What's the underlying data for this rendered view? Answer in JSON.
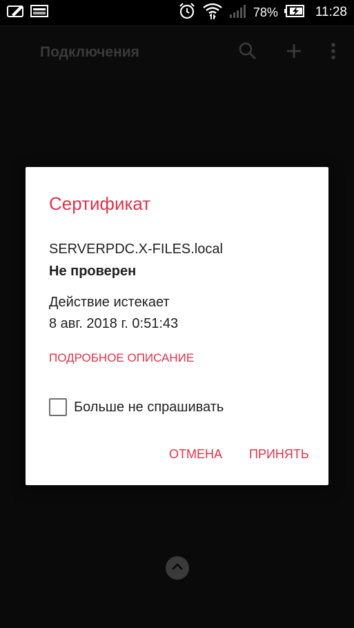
{
  "status_bar": {
    "battery_percent": "78%",
    "time": "11:28",
    "icons": [
      "edit-note-icon",
      "image-icon",
      "alarm-icon",
      "wifi-icon",
      "signal-icon",
      "battery-charging-icon"
    ]
  },
  "app_bar": {
    "title": "Подключения",
    "actions": [
      "search-icon",
      "add-icon",
      "more-vert-icon"
    ]
  },
  "dialog": {
    "title": "Сертификат",
    "host": "SERVERPDC.X-FILES.local",
    "status": "Не проверен",
    "expires_label": "Действие истекает",
    "expires_date": "8 авг. 2018 г. 0:51:43",
    "details_link": "ПОДРОБНОЕ ОПИСАНИЕ",
    "checkbox_label": "Больше не спрашивать",
    "checkbox_checked": false,
    "cancel_button": "ОТМЕНА",
    "accept_button": "ПРИНЯТЬ"
  },
  "colors": {
    "accent": "#e0324b",
    "dialog_bg": "#ffffff",
    "scrim": "#0a0a0a",
    "text_primary": "#1f1f1f"
  }
}
